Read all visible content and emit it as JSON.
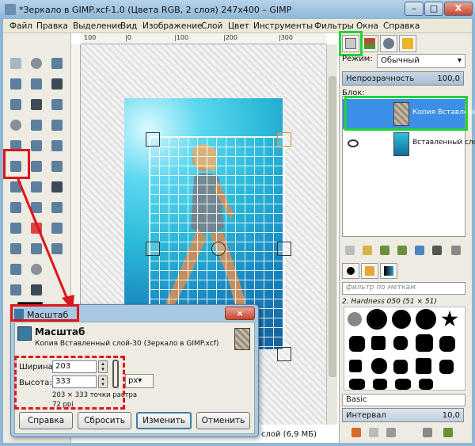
{
  "window": {
    "title": "*Зеркало в GIMP.xcf-1.0 (Цвета RGB, 2 слоя) 247x400 – GIMP",
    "min_glyph": "–",
    "max_glyph": "□",
    "close_glyph": "X"
  },
  "menu": {
    "items": [
      "Файл",
      "Правка",
      "Выделение",
      "Вид",
      "Изображение",
      "Слой",
      "Цвет",
      "Инструменты",
      "Фильтры",
      "Окна",
      "Справка"
    ]
  },
  "ruler": {
    "labels": [
      "100",
      "|0",
      "|100",
      "|200",
      "|300"
    ]
  },
  "status": {
    "text": "слой (6,9 МБ)"
  },
  "layers": {
    "mode_label": "Режим:",
    "mode_value": "Обычный",
    "opacity_label": "Непрозрачность",
    "opacity_value": "100,0",
    "lock_label": "Блок:",
    "items": [
      {
        "name": "Копия Вставленн",
        "selected": true
      },
      {
        "name": "Вставленный слой",
        "selected": false
      }
    ]
  },
  "brushes": {
    "filter_placeholder": "фильтр по меткам",
    "current": "2. Hardness 050 (51 × 51)",
    "preset": "Basic",
    "interval_label": "Интервал",
    "interval_value": "10,0"
  },
  "scale_dialog": {
    "title": "Масштаб",
    "heading": "Масштаб",
    "subtitle": "Копия Вставленный слой-30 (Зеркало в GIMP.xcf)",
    "width_label": "Ширина:",
    "width_value": "203",
    "height_label": "Высота:",
    "height_value": "333",
    "unit_value": "px",
    "size_info": "203 × 333 точки растра",
    "resolution_info": "72 ppi",
    "buttons": {
      "help": "Справка",
      "reset": "Сбросить",
      "scale": "Изменить",
      "cancel": "Отменить"
    }
  },
  "colors": {
    "highlight_red": "#e0151a",
    "highlight_green": "#22d33a",
    "selection_blue": "#3b8fe6"
  }
}
